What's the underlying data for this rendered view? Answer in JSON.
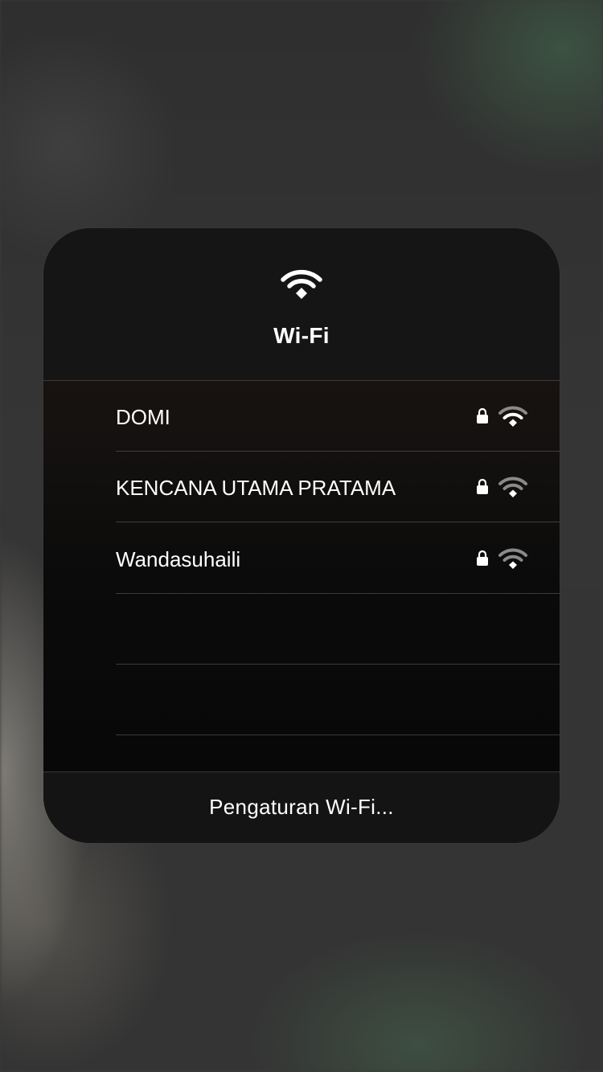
{
  "panel": {
    "title": "Wi-Fi",
    "header_icon": "wifi-icon"
  },
  "networks": [
    {
      "name": "DOMI",
      "secured": true,
      "lock_icon": "lock-icon",
      "signal_icon": "wifi-signal-icon"
    },
    {
      "name": "KENCANA UTAMA PRATAMA",
      "secured": true,
      "lock_icon": "lock-icon",
      "signal_icon": "wifi-signal-icon"
    },
    {
      "name": "Wandasuhaili",
      "secured": true,
      "lock_icon": "lock-icon",
      "signal_icon": "wifi-signal-icon"
    }
  ],
  "footer": {
    "settings_label": "Pengaturan Wi-Fi..."
  },
  "colors": {
    "text": "#ffffff",
    "panel_background": "#141414",
    "signal_full": "#ffffff",
    "signal_dim": "#8a8a8a"
  }
}
